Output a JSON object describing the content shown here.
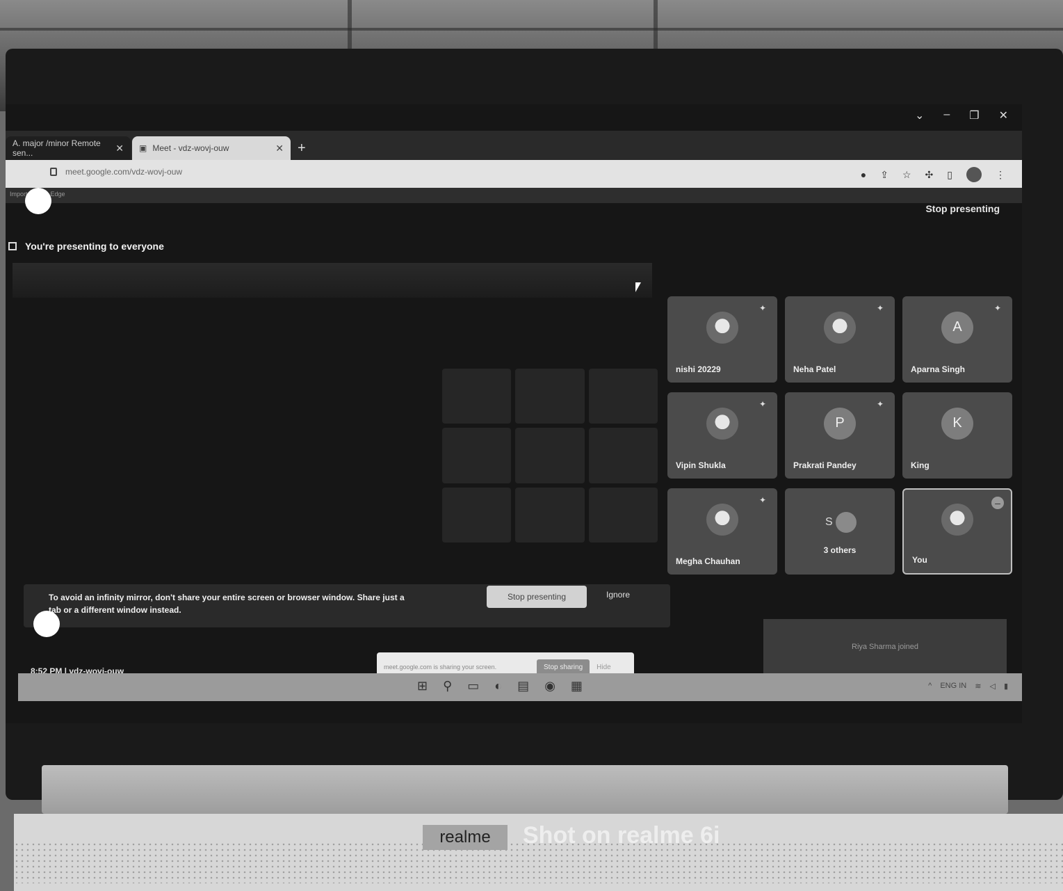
{
  "browser": {
    "tabs": [
      {
        "label": "A. major /minor Remote sen..."
      },
      {
        "label": "Meet - vdz-wovj-ouw"
      }
    ],
    "url": "meet.google.com/vdz-wovj-ouw",
    "bookmark_text": "Imported from Edge"
  },
  "meet": {
    "stop_presenting": "Stop presenting",
    "presenting_banner": "You're presenting to everyone",
    "participants": [
      {
        "name": "nishi 20229",
        "avatar_type": "photo",
        "pinned": true
      },
      {
        "name": "Neha Patel",
        "avatar_type": "photo",
        "pinned": true
      },
      {
        "name": "Aparna Singh",
        "avatar_type": "letter",
        "initial": "A",
        "pinned": true
      },
      {
        "name": "Vipin Shukla",
        "avatar_type": "photo",
        "pinned": true
      },
      {
        "name": "Prakrati Pandey",
        "avatar_type": "letter",
        "initial": "P",
        "pinned": true
      },
      {
        "name": "King",
        "avatar_type": "letter",
        "initial": "K",
        "pinned": false
      },
      {
        "name": "Megha Chauhan",
        "avatar_type": "photo",
        "pinned": true
      },
      {
        "name": "3 others",
        "avatar_type": "group",
        "initial": "S",
        "pinned": false
      },
      {
        "name": "You",
        "avatar_type": "photo",
        "pinned": false
      }
    ],
    "warning": {
      "text": "To avoid an infinity mirror, don't share your entire screen or browser window. Share just a tab or a different window instead.",
      "stop_label": "Stop presenting",
      "ignore_label": "Ignore"
    },
    "joined_toast": "Riya Sharma joined",
    "meeting_time": "8:52 PM | vdz-wovj-ouw",
    "share_notice": {
      "text": "meet.google.com is sharing your screen.",
      "stop_label": "Stop sharing",
      "hide_label": "Hide"
    }
  },
  "taskbar": {
    "tray_text": "ENG IN"
  },
  "device": {
    "brand": "realme",
    "watermark": "Shot on realme 6i"
  }
}
